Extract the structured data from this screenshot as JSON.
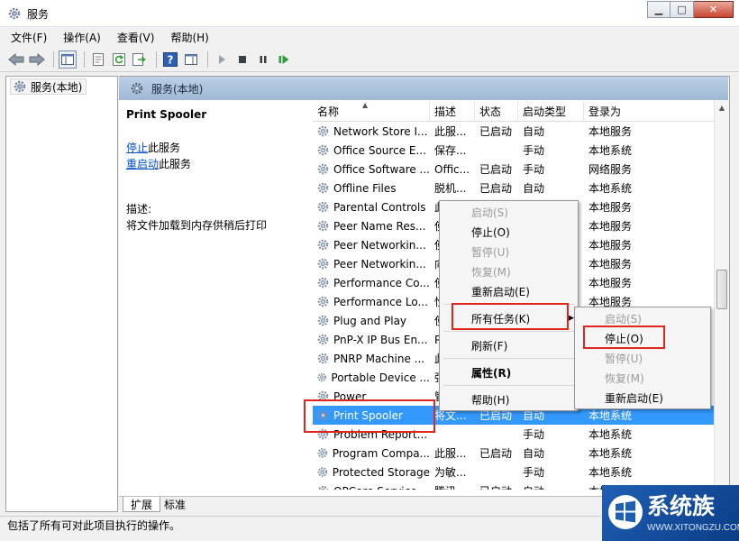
{
  "window": {
    "title": "服务"
  },
  "menu": [
    "文件(F)",
    "操作(A)",
    "查看(V)",
    "帮助(H)"
  ],
  "tree": {
    "root_label": "服务(本地)"
  },
  "content_header": {
    "title": "服务(本地)"
  },
  "detail": {
    "service_name": "Print Spooler",
    "stop_link": "停止",
    "stop_suffix": "此服务",
    "restart_link": "重启动",
    "restart_suffix": "此服务",
    "desc_label": "描述:",
    "desc_text": "将文件加载到内存供稍后打印"
  },
  "columns": {
    "name": "名称",
    "desc": "描述",
    "status": "状态",
    "startup": "启动类型",
    "logon": "登录为"
  },
  "rows": [
    {
      "name": "Network Store I...",
      "desc": "此服...",
      "status": "已启动",
      "startup": "自动",
      "logon": "本地服务"
    },
    {
      "name": "Office  Source E...",
      "desc": "保存...",
      "status": "",
      "startup": "手动",
      "logon": "本地系统"
    },
    {
      "name": "Office Software ...",
      "desc": "Offic...",
      "status": "已启动",
      "startup": "手动",
      "logon": "网络服务"
    },
    {
      "name": "Offline Files",
      "desc": "脱机...",
      "status": "已启动",
      "startup": "自动",
      "logon": "本地系统"
    },
    {
      "name": "Parental Controls",
      "desc": "此",
      "status": "",
      "startup": "",
      "logon": "本地服务"
    },
    {
      "name": "Peer Name Res...",
      "desc": "使",
      "status": "",
      "startup": "",
      "logon": "本地服务"
    },
    {
      "name": "Peer Networkin...",
      "desc": "使",
      "status": "",
      "startup": "",
      "logon": "本地服务"
    },
    {
      "name": "Peer Networkin...",
      "desc": "向",
      "status": "",
      "startup": "",
      "logon": "本地服务"
    },
    {
      "name": "Performance Co...",
      "desc": "使",
      "status": "",
      "startup": "",
      "logon": "本地服务"
    },
    {
      "name": "Performance Lo...",
      "desc": "性",
      "status": "",
      "startup": "",
      "logon": "本地服务"
    },
    {
      "name": "Plug and Play",
      "desc": "使",
      "status": "",
      "startup": "",
      "logon": ""
    },
    {
      "name": "PnP-X IP Bus En...",
      "desc": "Pn",
      "status": "",
      "startup": "",
      "logon": ""
    },
    {
      "name": "PNRP Machine ...",
      "desc": "此",
      "status": "",
      "startup": "",
      "logon": ""
    },
    {
      "name": "Portable Device ...",
      "desc": "强",
      "status": "",
      "startup": "",
      "logon": ""
    },
    {
      "name": "Power",
      "desc": "管",
      "status": "",
      "startup": "",
      "logon": ""
    },
    {
      "name": "Print Spooler",
      "desc": "将文...",
      "status": "已启动",
      "startup": "自动",
      "logon": "本地系统"
    },
    {
      "name": "Problem Report...",
      "desc": "",
      "status": "",
      "startup": "手动",
      "logon": "本地系统"
    },
    {
      "name": "Program Compa...",
      "desc": "此服...",
      "status": "已启动",
      "startup": "自动",
      "logon": "本地系统"
    },
    {
      "name": "Protected Storage",
      "desc": "为敏...",
      "status": "",
      "startup": "手动",
      "logon": "本地系统"
    },
    {
      "name": "QPCore Service",
      "desc": "腾讯...",
      "status": "已启动",
      "startup": "自动",
      "logon": "本地系统"
    }
  ],
  "context_menu": {
    "start": "启动(S)",
    "stop": "停止(O)",
    "pause": "暂停(U)",
    "resume": "恢复(M)",
    "restart": "重新启动(E)",
    "all_tasks": "所有任务(K)",
    "refresh": "刷新(F)",
    "properties": "属性(R)",
    "help": "帮助(H)"
  },
  "submenu": {
    "start": "启动(S)",
    "stop": "停止(O)",
    "pause": "暂停(U)",
    "resume": "恢复(M)",
    "restart": "重新启动(E)"
  },
  "tabs": {
    "extended": "扩展",
    "standard": "标准"
  },
  "status_bar": "包括了所有可对此项目执行的操作。",
  "watermark": {
    "main": "系统族",
    "sub": "WWW.XITONGZU.COM"
  },
  "colors": {
    "selection": "#3399ff",
    "highlight_box": "#e0261c",
    "link": "#0050c8"
  }
}
